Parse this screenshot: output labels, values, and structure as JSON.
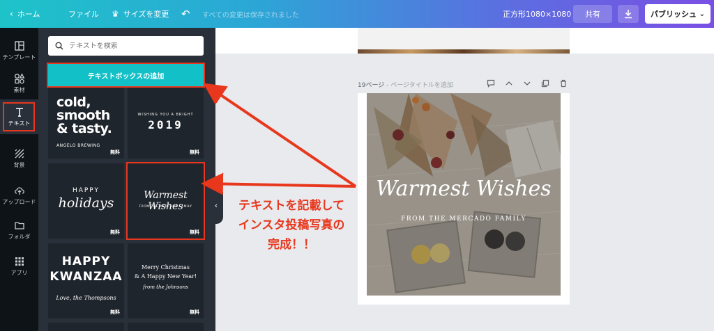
{
  "topbar": {
    "home": "ホーム",
    "file": "ファイル",
    "resize": "サイズを変更",
    "saved": "すべての変更は保存されました",
    "size_label": "正方形1080×1080",
    "share": "共有",
    "publish": "パブリッシュ"
  },
  "rail": [
    {
      "label": "テンプレート",
      "icon": "template-icon"
    },
    {
      "label": "素材",
      "icon": "elements-icon"
    },
    {
      "label": "テキスト",
      "icon": "text-icon"
    },
    {
      "label": "背景",
      "icon": "background-icon"
    },
    {
      "label": "アップロード",
      "icon": "upload-icon"
    },
    {
      "label": "フォルダ",
      "icon": "folder-icon"
    },
    {
      "label": "アプリ",
      "icon": "apps-icon"
    }
  ],
  "panel": {
    "search_placeholder": "テキストを検索",
    "add_textbox": "テキストボックスの追加",
    "free_badge": "無料",
    "templates": {
      "cold_lines": [
        "cold,",
        "smooth",
        "& tasty."
      ],
      "cold_sub": "ANGELO BREWING",
      "wishing": "WISHING YOU A BRIGHT",
      "year": "2019",
      "happy": "HAPPY",
      "holidays": "holidays",
      "warmest": "Warmest Wishes",
      "mercado": "FROM THE MERCADO FAMILY",
      "hk_line1": "HAPPY",
      "hk_line2": "KWANZAA",
      "hk_line3": "Love, the Thompsons",
      "mc_line1": "Merry Christmas",
      "mc_line2": "& A Happy New Year!",
      "mc_line3": "from the Johnsons"
    }
  },
  "page": {
    "number": "19ページ",
    "title_hint": " - ページタイトルを追加",
    "main_text": "Warmest Wishes",
    "sub_text": "FROM THE MERCADO FAMILY"
  },
  "annotation": {
    "lines": [
      "テキストを記載して",
      "インスタ投稿写真の",
      "完成！！"
    ]
  },
  "colors": {
    "accent_red": "#e8371d",
    "teal": "#12c0c7",
    "panel_bg": "#293039"
  }
}
